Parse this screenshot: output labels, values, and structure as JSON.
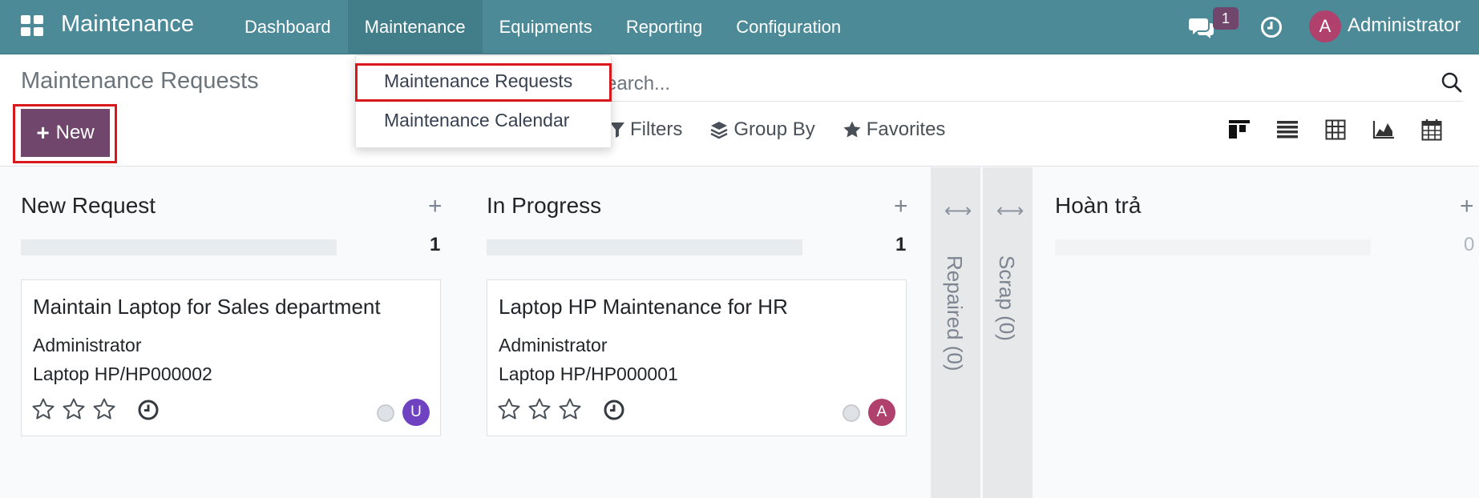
{
  "navbar": {
    "app_name": "Maintenance",
    "menu": [
      {
        "label": "Dashboard"
      },
      {
        "label": "Maintenance"
      },
      {
        "label": "Equipments"
      },
      {
        "label": "Reporting"
      },
      {
        "label": "Configuration"
      }
    ],
    "message_count": "1",
    "user_initial": "A",
    "user_name": "Administrator"
  },
  "dropdown": {
    "items": [
      {
        "label": "Maintenance Requests"
      },
      {
        "label": "Maintenance Calendar"
      }
    ]
  },
  "control_panel": {
    "title": "Maintenance Requests",
    "new_label": "New",
    "search_placeholder": "Search...",
    "filters_label": "Filters",
    "group_by_label": "Group By",
    "favorites_label": "Favorites"
  },
  "kanban": {
    "columns": [
      {
        "title": "New Request",
        "count": "1",
        "cards": [
          {
            "title": "Maintain Laptop for Sales department",
            "owner": "Administrator",
            "equipment": "Laptop HP/HP000002",
            "avatar": "U",
            "avatar_color": "#6f42c1"
          }
        ]
      },
      {
        "title": "In Progress",
        "count": "1",
        "cards": [
          {
            "title": "Laptop HP Maintenance for HR",
            "owner": "Administrator",
            "equipment": "Laptop HP/HP000001",
            "avatar": "A",
            "avatar_color": "#b0416d"
          }
        ]
      },
      {
        "title": "Repaired (0)",
        "folded": true
      },
      {
        "title": "Scrap (0)",
        "folded": true
      },
      {
        "title": "Hoàn trả",
        "count": "0"
      }
    ]
  },
  "colors": {
    "navbar": "#4c8a97",
    "primary": "#71466d",
    "highlight_frame": "#d8181b"
  }
}
